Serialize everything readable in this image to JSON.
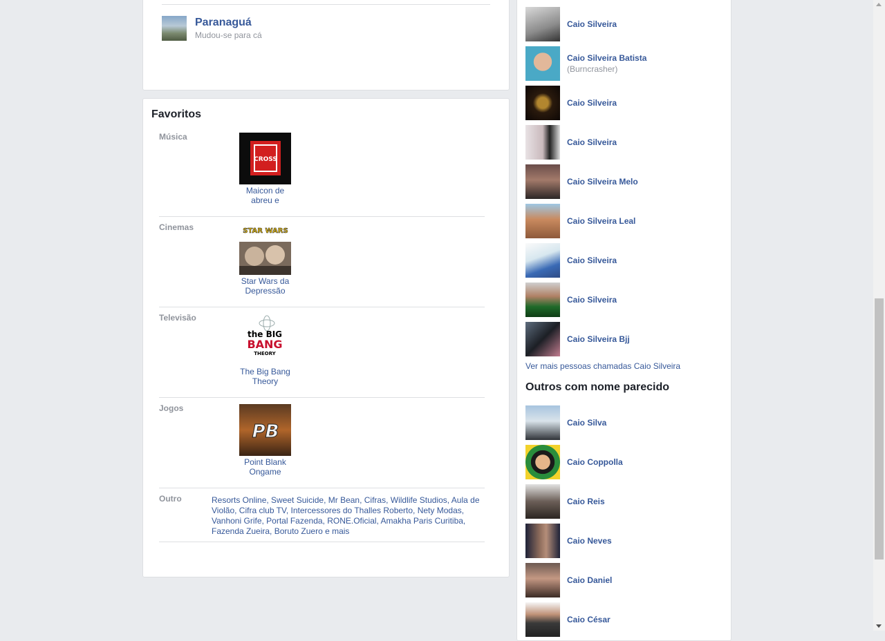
{
  "place": {
    "name": "Paranaguá",
    "sub": "Mudou-se para cá"
  },
  "favorites": {
    "title": "Favoritos",
    "rows": [
      {
        "category": "Música",
        "item": "Maicon de abreu e"
      },
      {
        "category": "Cinemas",
        "item": "Star Wars da Depressão"
      },
      {
        "category": "Televisão",
        "item": "The Big Bang Theory"
      },
      {
        "category": "Jogos",
        "item": "Point Blank Ongame"
      }
    ],
    "outro_category": "Outro",
    "outro_text": "Resorts Online, Sweet Suicide, Mr Bean, Cifras, Wildlife Studios, Aula de Violão, Cifra club TV, Intercessores do Thalles Roberto, Nety Modas, Vanhoni Grife, Portal Fazenda, RONE.Oficial, Amakha Paris Curitiba, Fazenda Zueira, Boruto Zuero e mais",
    "logo_texts": {
      "music": "CROSS",
      "tv_top": "the BIG",
      "tv_mid": "BANG",
      "tv_bot": "THEORY",
      "game": "PB",
      "movie": "STAR WARS"
    }
  },
  "people": [
    {
      "name": "Caio Silveira",
      "sub": ""
    },
    {
      "name": "Caio Silveira Batista",
      "sub": "(Burncrasher)"
    },
    {
      "name": "Caio Silveira",
      "sub": ""
    },
    {
      "name": "Caio Silveira",
      "sub": ""
    },
    {
      "name": "Caio Silveira Melo",
      "sub": ""
    },
    {
      "name": "Caio Silveira Leal",
      "sub": ""
    },
    {
      "name": "Caio Silveira",
      "sub": ""
    },
    {
      "name": "Caio Silveira",
      "sub": ""
    },
    {
      "name": "Caio Silveira Bjj",
      "sub": ""
    }
  ],
  "see_more": "Ver mais pessoas chamadas Caio Silveira",
  "similar_title": "Outros com nome parecido",
  "similar": [
    {
      "name": "Caio Silva"
    },
    {
      "name": "Caio Coppolla"
    },
    {
      "name": "Caio Reis"
    },
    {
      "name": "Caio Neves"
    },
    {
      "name": "Caio Daniel"
    },
    {
      "name": "Caio César"
    }
  ],
  "colors": {
    "link": "#365899",
    "muted": "#90949c",
    "background": "#e9ebee"
  }
}
